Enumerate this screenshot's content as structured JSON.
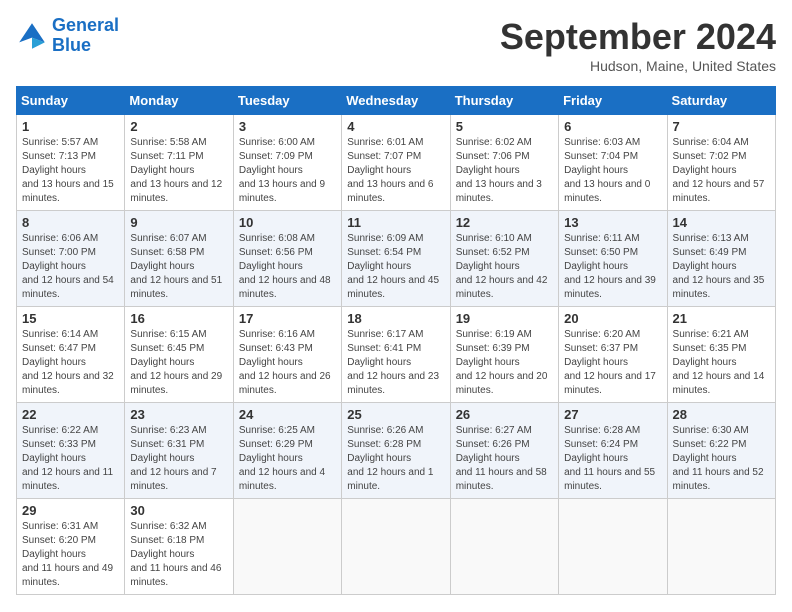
{
  "logo": {
    "line1": "General",
    "line2": "Blue"
  },
  "title": "September 2024",
  "location": "Hudson, Maine, United States",
  "days_of_week": [
    "Sunday",
    "Monday",
    "Tuesday",
    "Wednesday",
    "Thursday",
    "Friday",
    "Saturday"
  ],
  "weeks": [
    [
      {
        "day": "1",
        "sunrise": "5:57 AM",
        "sunset": "7:13 PM",
        "daylight": "13 hours and 15 minutes."
      },
      {
        "day": "2",
        "sunrise": "5:58 AM",
        "sunset": "7:11 PM",
        "daylight": "13 hours and 12 minutes."
      },
      {
        "day": "3",
        "sunrise": "6:00 AM",
        "sunset": "7:09 PM",
        "daylight": "13 hours and 9 minutes."
      },
      {
        "day": "4",
        "sunrise": "6:01 AM",
        "sunset": "7:07 PM",
        "daylight": "13 hours and 6 minutes."
      },
      {
        "day": "5",
        "sunrise": "6:02 AM",
        "sunset": "7:06 PM",
        "daylight": "13 hours and 3 minutes."
      },
      {
        "day": "6",
        "sunrise": "6:03 AM",
        "sunset": "7:04 PM",
        "daylight": "13 hours and 0 minutes."
      },
      {
        "day": "7",
        "sunrise": "6:04 AM",
        "sunset": "7:02 PM",
        "daylight": "12 hours and 57 minutes."
      }
    ],
    [
      {
        "day": "8",
        "sunrise": "6:06 AM",
        "sunset": "7:00 PM",
        "daylight": "12 hours and 54 minutes."
      },
      {
        "day": "9",
        "sunrise": "6:07 AM",
        "sunset": "6:58 PM",
        "daylight": "12 hours and 51 minutes."
      },
      {
        "day": "10",
        "sunrise": "6:08 AM",
        "sunset": "6:56 PM",
        "daylight": "12 hours and 48 minutes."
      },
      {
        "day": "11",
        "sunrise": "6:09 AM",
        "sunset": "6:54 PM",
        "daylight": "12 hours and 45 minutes."
      },
      {
        "day": "12",
        "sunrise": "6:10 AM",
        "sunset": "6:52 PM",
        "daylight": "12 hours and 42 minutes."
      },
      {
        "day": "13",
        "sunrise": "6:11 AM",
        "sunset": "6:50 PM",
        "daylight": "12 hours and 39 minutes."
      },
      {
        "day": "14",
        "sunrise": "6:13 AM",
        "sunset": "6:49 PM",
        "daylight": "12 hours and 35 minutes."
      }
    ],
    [
      {
        "day": "15",
        "sunrise": "6:14 AM",
        "sunset": "6:47 PM",
        "daylight": "12 hours and 32 minutes."
      },
      {
        "day": "16",
        "sunrise": "6:15 AM",
        "sunset": "6:45 PM",
        "daylight": "12 hours and 29 minutes."
      },
      {
        "day": "17",
        "sunrise": "6:16 AM",
        "sunset": "6:43 PM",
        "daylight": "12 hours and 26 minutes."
      },
      {
        "day": "18",
        "sunrise": "6:17 AM",
        "sunset": "6:41 PM",
        "daylight": "12 hours and 23 minutes."
      },
      {
        "day": "19",
        "sunrise": "6:19 AM",
        "sunset": "6:39 PM",
        "daylight": "12 hours and 20 minutes."
      },
      {
        "day": "20",
        "sunrise": "6:20 AM",
        "sunset": "6:37 PM",
        "daylight": "12 hours and 17 minutes."
      },
      {
        "day": "21",
        "sunrise": "6:21 AM",
        "sunset": "6:35 PM",
        "daylight": "12 hours and 14 minutes."
      }
    ],
    [
      {
        "day": "22",
        "sunrise": "6:22 AM",
        "sunset": "6:33 PM",
        "daylight": "12 hours and 11 minutes."
      },
      {
        "day": "23",
        "sunrise": "6:23 AM",
        "sunset": "6:31 PM",
        "daylight": "12 hours and 7 minutes."
      },
      {
        "day": "24",
        "sunrise": "6:25 AM",
        "sunset": "6:29 PM",
        "daylight": "12 hours and 4 minutes."
      },
      {
        "day": "25",
        "sunrise": "6:26 AM",
        "sunset": "6:28 PM",
        "daylight": "12 hours and 1 minute."
      },
      {
        "day": "26",
        "sunrise": "6:27 AM",
        "sunset": "6:26 PM",
        "daylight": "11 hours and 58 minutes."
      },
      {
        "day": "27",
        "sunrise": "6:28 AM",
        "sunset": "6:24 PM",
        "daylight": "11 hours and 55 minutes."
      },
      {
        "day": "28",
        "sunrise": "6:30 AM",
        "sunset": "6:22 PM",
        "daylight": "11 hours and 52 minutes."
      }
    ],
    [
      {
        "day": "29",
        "sunrise": "6:31 AM",
        "sunset": "6:20 PM",
        "daylight": "11 hours and 49 minutes."
      },
      {
        "day": "30",
        "sunrise": "6:32 AM",
        "sunset": "6:18 PM",
        "daylight": "11 hours and 46 minutes."
      },
      null,
      null,
      null,
      null,
      null
    ]
  ]
}
